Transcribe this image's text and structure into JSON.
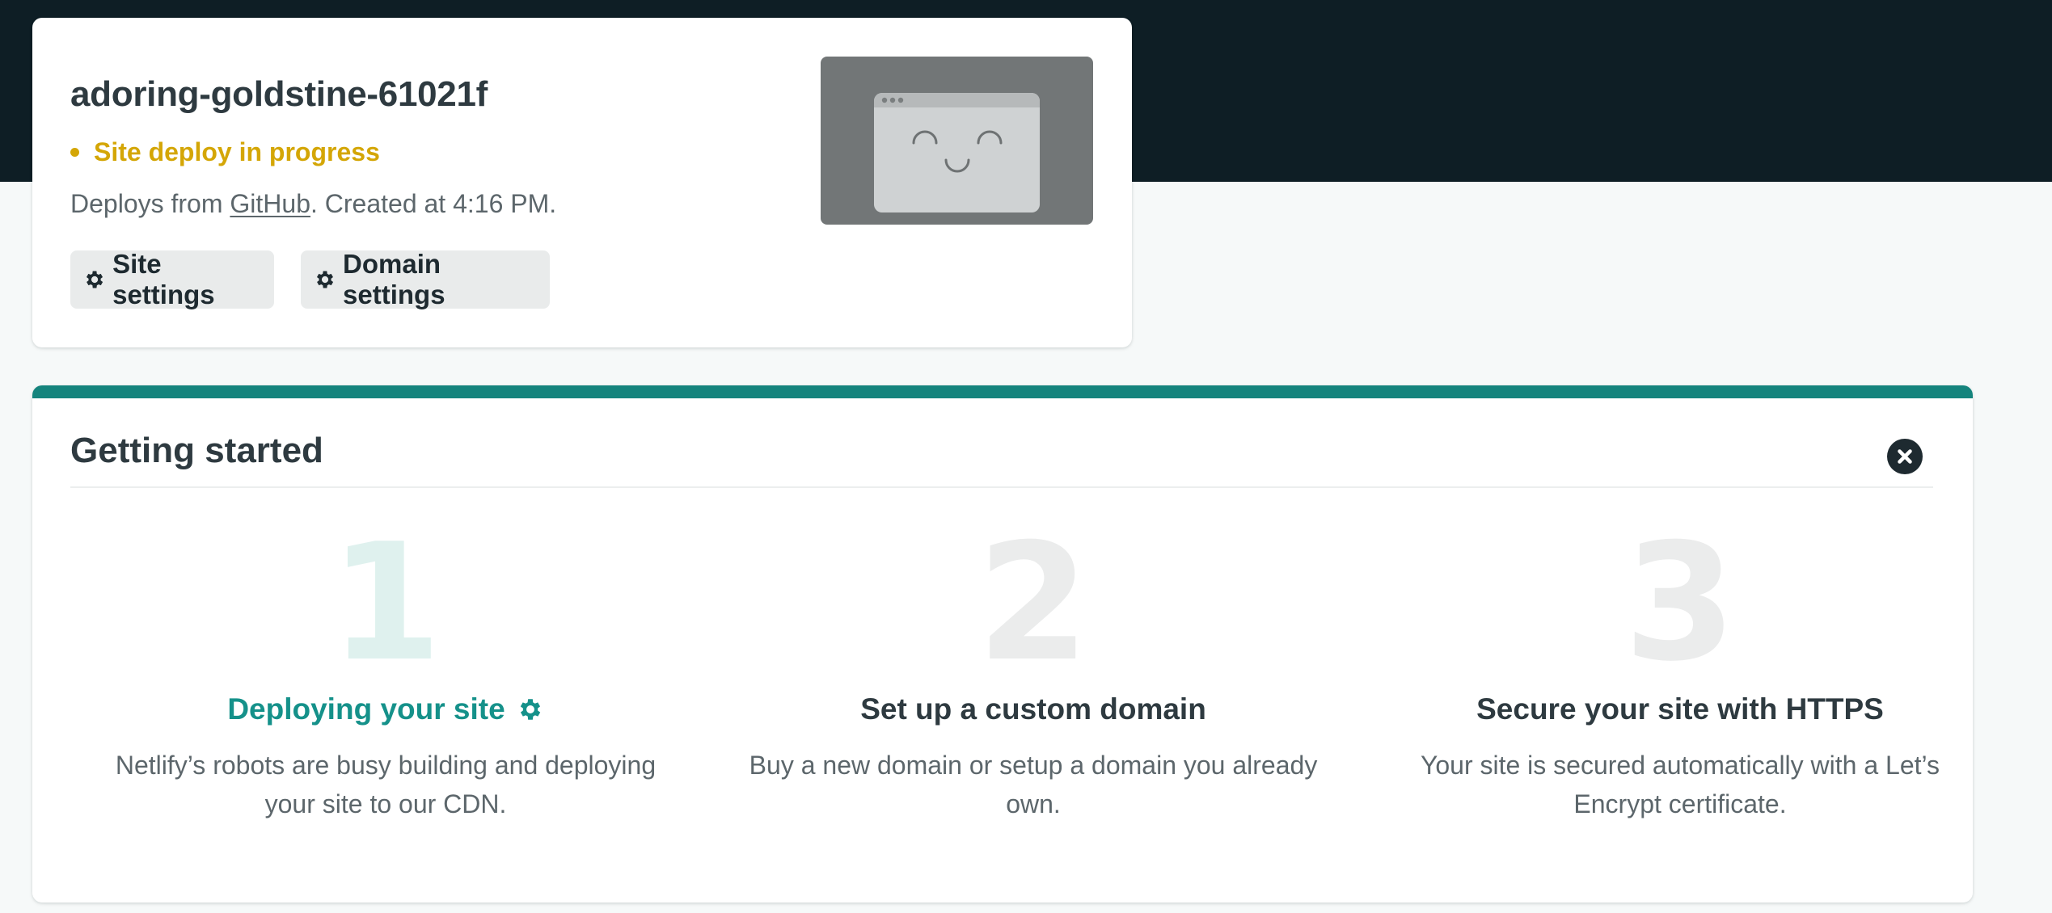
{
  "site": {
    "name": "adoring-goldstine-61021f",
    "status": "Site deploy in progress",
    "deploy_prefix": "Deploys from ",
    "deploy_source": "GitHub",
    "deploy_suffix": ". Created at 4:16 PM.",
    "preview_icon": "smiling-browser-window-illustration"
  },
  "buttons": {
    "site_settings": "Site settings",
    "domain_settings": "Domain settings",
    "icon": "gear-icon"
  },
  "getting_started": {
    "title": "Getting started",
    "close_icon": "close-circle-icon",
    "steps": [
      {
        "number": "1",
        "title": "Deploying your site",
        "description": "Netlify’s robots are busy building and deploying your site to our CDN.",
        "active": true,
        "icon": "gear-icon"
      },
      {
        "number": "2",
        "title": "Set up a custom domain",
        "description": "Buy a new domain or setup a domain you already own.",
        "active": false
      },
      {
        "number": "3",
        "title": "Secure your site with HTTPS",
        "description": "Your site is secured automatically with a Let’s Encrypt certificate.",
        "active": false
      }
    ]
  },
  "colors": {
    "header_bg": "#0e1e25",
    "page_bg": "#f6f9f9",
    "accent_teal": "#15847d",
    "status_yellow": "#d4a606",
    "text_dark": "#2e3a40",
    "text_muted": "#5c666b"
  }
}
